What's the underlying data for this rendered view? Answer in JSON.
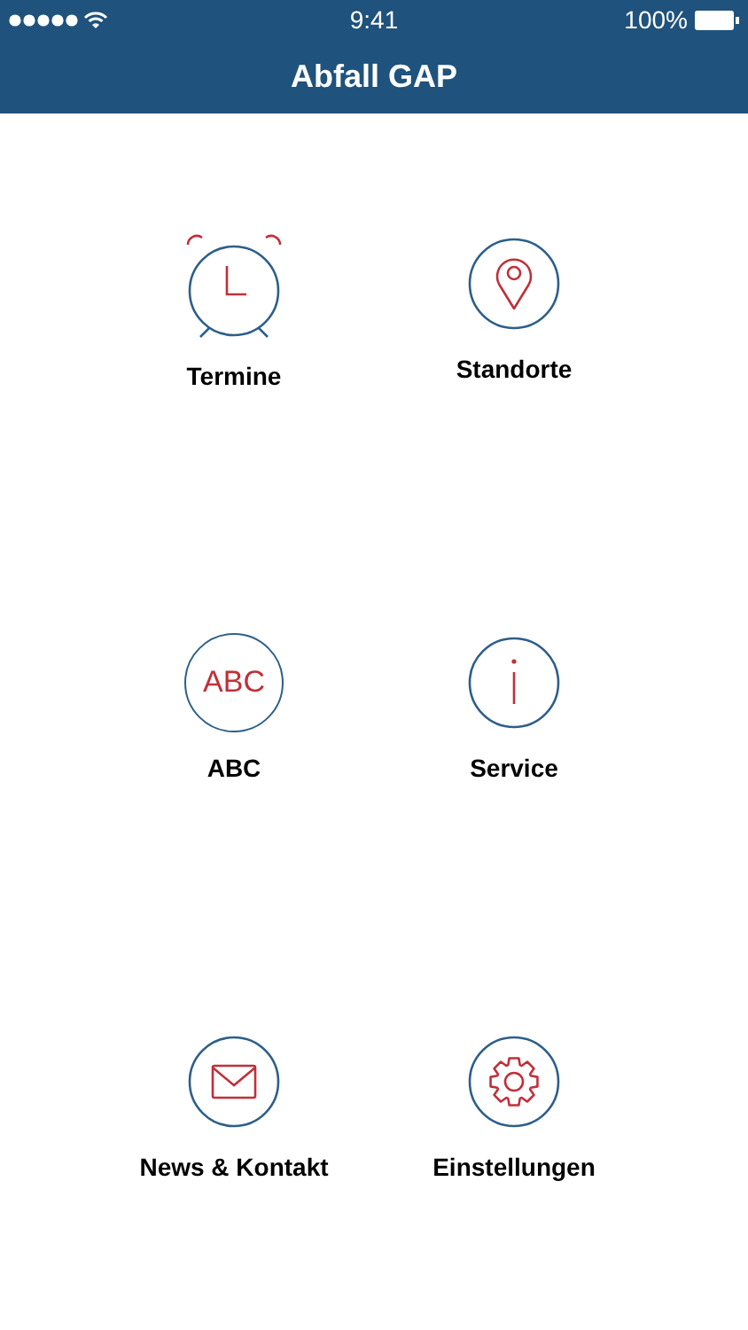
{
  "status_bar": {
    "time": "9:41",
    "battery": "100%"
  },
  "header": {
    "title": "Abfall GAP"
  },
  "menu": [
    {
      "kind": "clock",
      "label": "Termine"
    },
    {
      "kind": "pin",
      "label": "Standorte"
    },
    {
      "kind": "abc",
      "label": "ABC",
      "icon_text": "ABC"
    },
    {
      "kind": "info",
      "label": "Service"
    },
    {
      "kind": "mail",
      "label": "News & Kontakt"
    },
    {
      "kind": "gear",
      "label": "Einstellungen"
    }
  ]
}
